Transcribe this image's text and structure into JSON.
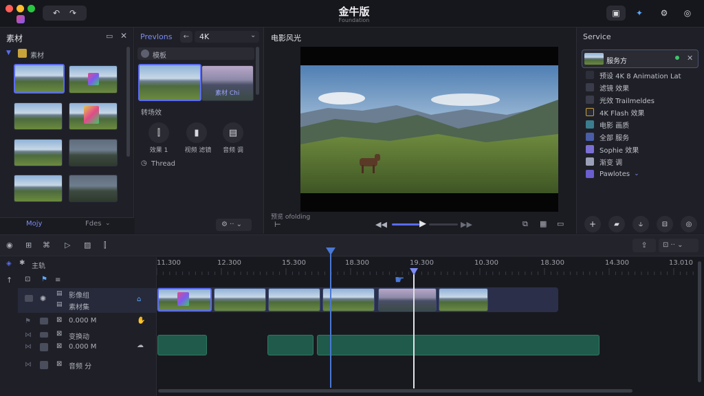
{
  "window": {
    "title": "金牛版",
    "subtitle": "Foundation",
    "toolbar_right_icons": [
      "image-icon",
      "sparkle-icon",
      "gear-icon",
      "timer-icon"
    ]
  },
  "media_panel": {
    "title": "素材",
    "folder_label": "素材",
    "thumb_captions": [
      "",
      "",
      "",
      "",
      "",
      "",
      "",
      ""
    ],
    "bottom_left_label": "Mojy",
    "bottom_right_label": "Fdes"
  },
  "effects_panel": {
    "title": "Prevlons",
    "dropdown_value": "4K",
    "section_label": "模板",
    "thumb2_label": "素材 Chi",
    "subsection_label": "转场效",
    "buttons": [
      "效果 1",
      "视频 滤镜",
      "音频 调"
    ],
    "thread_label": "Thread"
  },
  "preview_panel": {
    "title": "电影风光",
    "status_label": "预览 ofolding"
  },
  "service_panel": {
    "title": "Service",
    "active_item": "服务方",
    "items": [
      {
        "label": "预设 4K 8 Animation Lat",
        "color": "#2d2f3a"
      },
      {
        "label": "滤镜 效果",
        "color": "#3a3c4a"
      },
      {
        "label": "光效 Trailmeldes",
        "color": "#3a3c4a"
      },
      {
        "label": "4K Flash 效果",
        "color": "#c8a23a"
      },
      {
        "label": "电影 画质",
        "color": "#3a7d8f"
      },
      {
        "label": "全部 服务",
        "color": "#4a5da8"
      },
      {
        "label": "Sophie 效果",
        "color": "#7b6fd6"
      },
      {
        "label": "渐变 调",
        "color": "#9aa0b8"
      },
      {
        "label": "Pawlotes",
        "color": "#6a5ed0"
      }
    ]
  },
  "timeline": {
    "ruler": [
      "11.300",
      "12.300",
      "15.300",
      "18.300",
      "19.300",
      "10.300",
      "18.300",
      "14.300",
      "13.010"
    ],
    "header_label": "主轨",
    "track1_labels": [
      "影像组",
      "素材集"
    ],
    "track2_label": "0.000 M",
    "track3_label": "变换动",
    "track4_label": "0.000 M",
    "track5_label": "音频 分"
  }
}
